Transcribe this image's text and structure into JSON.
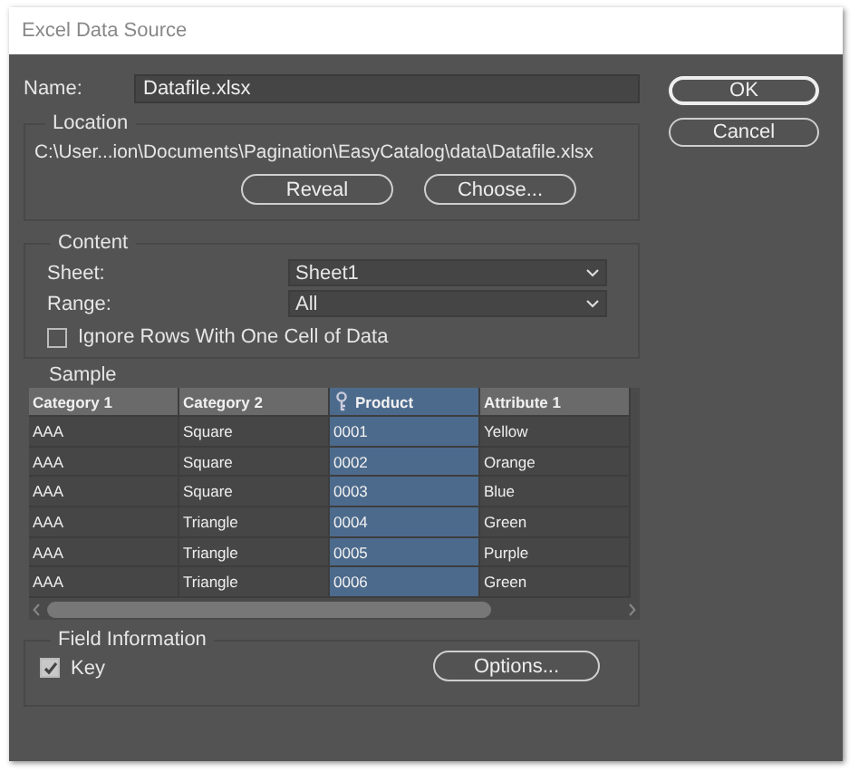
{
  "window": {
    "title": "Excel Data Source"
  },
  "name": {
    "label": "Name:",
    "value": "Datafile.xlsx"
  },
  "location": {
    "legend": "Location",
    "path": "C:\\User...ion\\Documents\\Pagination\\EasyCatalog\\data\\Datafile.xlsx",
    "buttons": [
      "Reveal",
      "Choose..."
    ]
  },
  "content": {
    "legend": "Content",
    "fields": [
      {
        "label": "Sheet:",
        "value": "Sheet1"
      },
      {
        "label": "Range:",
        "value": "All"
      }
    ],
    "ignore_rows": {
      "label": "Ignore Rows With One Cell of Data",
      "checked": false
    }
  },
  "sample": {
    "legend": "Sample",
    "columns": [
      {
        "label": "Category 1",
        "selected": false,
        "key": false
      },
      {
        "label": "Category 2",
        "selected": false,
        "key": false
      },
      {
        "label": "Product",
        "selected": true,
        "key": true
      },
      {
        "label": "Attribute 1",
        "selected": false,
        "key": false
      }
    ],
    "rows": [
      [
        "AAA",
        "Square",
        "0001",
        "Yellow"
      ],
      [
        "AAA",
        "Square",
        "0002",
        "Orange"
      ],
      [
        "AAA",
        "Square",
        "0003",
        "Blue"
      ],
      [
        "AAA",
        "Triangle",
        "0004",
        "Green"
      ],
      [
        "AAA",
        "Triangle",
        "0005",
        "Purple"
      ],
      [
        "AAA",
        "Triangle",
        "0006",
        "Green"
      ]
    ]
  },
  "field_information": {
    "legend": "Field Information",
    "key": {
      "label": "Key",
      "checked": true
    },
    "options_button": "Options..."
  },
  "buttons": [
    {
      "label": "OK",
      "default": true
    },
    {
      "label": "Cancel",
      "default": false
    }
  ]
}
